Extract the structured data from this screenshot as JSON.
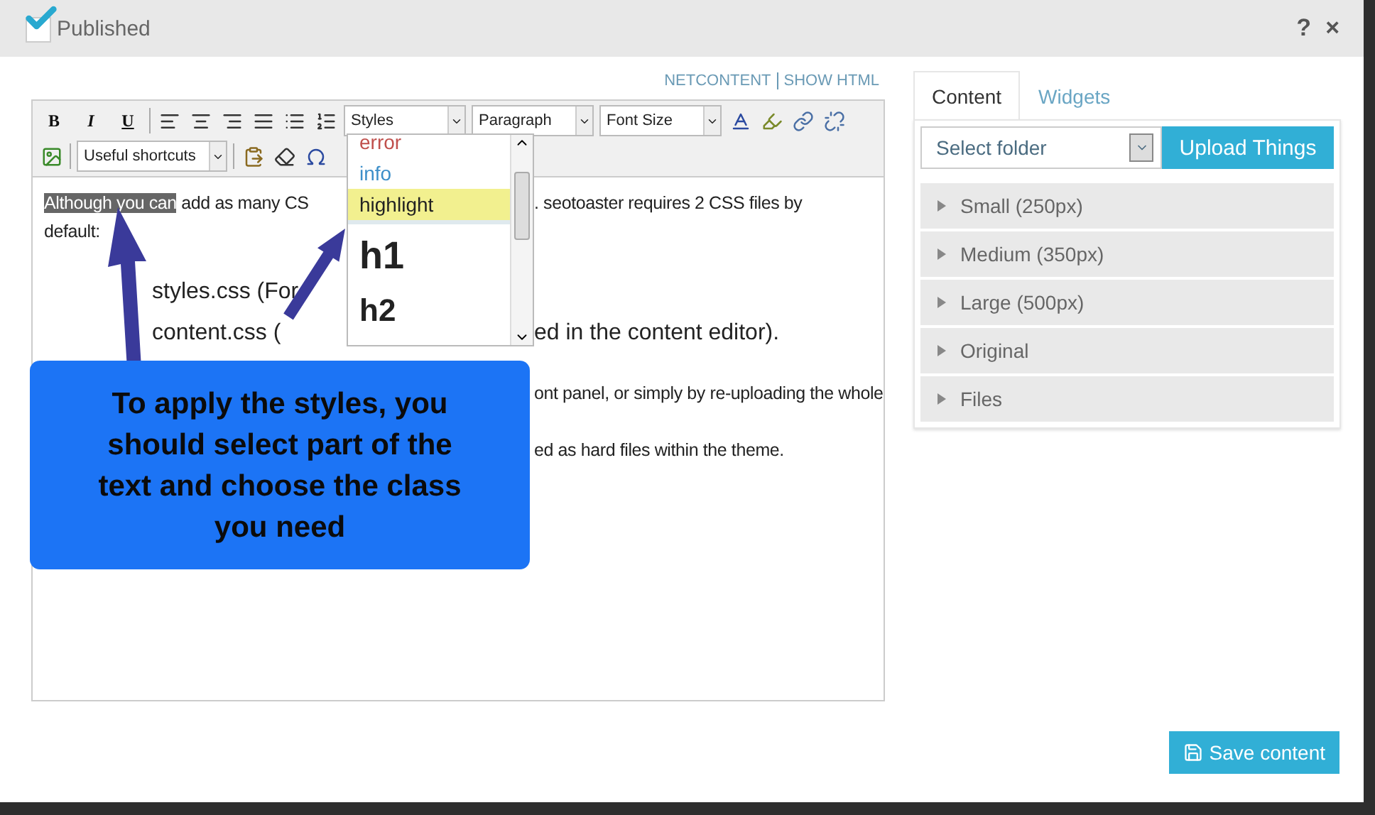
{
  "header": {
    "published": {
      "label": "Published",
      "checked": true
    },
    "buttons": [
      "?",
      "×"
    ]
  },
  "editor_links": [
    "NETCONTENT",
    "SHOW HTML"
  ],
  "toolbar": {
    "format_buttons": [
      "B",
      "I",
      "U"
    ],
    "styles_select": "Styles",
    "format_select": "Paragraph",
    "size_select": "Font Size",
    "shortcuts_select": "Useful shortcuts"
  },
  "styles_menu": [
    {
      "label": "error",
      "kind": "error",
      "selected": false
    },
    {
      "label": "info",
      "kind": "info",
      "selected": false
    },
    {
      "label": "highlight",
      "kind": "highlight",
      "selected": true
    },
    {
      "label": "h1",
      "kind": "h1",
      "selected": false
    },
    {
      "label": "h2",
      "kind": "h2",
      "selected": false
    }
  ],
  "content": [
    {
      "kind": "para",
      "selection": "Although you can",
      "left": " add as many CS",
      "right": ". seotoaster requires 2 CSS files by"
    },
    {
      "kind": "para",
      "left": "default:"
    },
    {
      "kind": "gap"
    },
    {
      "kind": "list",
      "left": "styles.css (For"
    },
    {
      "kind": "list",
      "left": "content.css (",
      "right": "ed in the content editor)."
    },
    {
      "kind": "gap"
    },
    {
      "kind": "para",
      "right": "ont panel, or simply by re-uploading the whole"
    },
    {
      "kind": "para"
    },
    {
      "kind": "para",
      "right": "ed as hard files within the theme."
    }
  ],
  "callout": "To apply the styles, you should select part of the text and choose the class you need",
  "side_panel": {
    "tabs": [
      {
        "label": "Content",
        "selected": true
      },
      {
        "label": "Widgets",
        "selected": false
      }
    ],
    "folder_select": {
      "placeholder": "Select folder"
    },
    "upload_button": "Upload Things",
    "sections": [
      {
        "label": "Small (250px)",
        "expanded": false
      },
      {
        "label": "Medium (350px)",
        "expanded": false
      },
      {
        "label": "Large (500px)",
        "expanded": false
      },
      {
        "label": "Original",
        "expanded": false
      },
      {
        "label": "Files",
        "expanded": false
      }
    ]
  },
  "save_button": "Save content"
}
